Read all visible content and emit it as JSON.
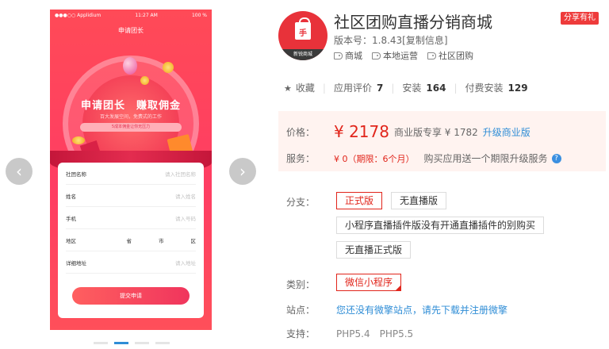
{
  "gallery": {
    "prev_icon": "chevron-left-icon",
    "next_icon": "chevron-right-icon",
    "prev_glyph": "‹",
    "next_glyph": "›",
    "phone": {
      "carrier": "●●●○○ Applidium",
      "time": "11:27 AM",
      "battery": "100 %",
      "header": "申请团长",
      "hero_title": "申请团长　赚取佣金",
      "hero_sub": "百大发展空间，免费式的工作",
      "hero_bar": "5成本佣金让你无压力",
      "form": {
        "rows": [
          {
            "label": "社团名称",
            "placeholder": "请入社团名称"
          },
          {
            "label": "姓名",
            "placeholder": "请入姓名"
          },
          {
            "label": "手机",
            "placeholder": "请入号码"
          }
        ],
        "region_label": "地区",
        "region_parts": [
          "省",
          "市",
          "区"
        ],
        "address_label": "详细地址",
        "address_placeholder": "请入地址",
        "submit": "提交申请"
      }
    }
  },
  "app": {
    "icon_glyph": "手",
    "icon_band": "新锐商城",
    "title": "社区团购直播分销商城",
    "share": "分享有礼",
    "version_label": "版本号：1.8.43",
    "version_link": "[复制信息]",
    "tags": [
      "商城",
      "本地运营",
      "社区团购"
    ]
  },
  "stats": {
    "favorite_label": "收藏",
    "rating_label": "应用评价",
    "rating_value": "7",
    "install_label": "安装",
    "install_value": "164",
    "paid_label": "付费安装",
    "paid_value": "129"
  },
  "price": {
    "label": "价格：",
    "amount": "¥ 2178",
    "pro_text": "商业版专享 ¥ 1782",
    "upgrade_link": "升级商业版",
    "service_label": "服务：",
    "service_value": "¥ 0（期限：6个月）",
    "service_desc": "购买应用送一个期限升级服务"
  },
  "branch": {
    "label": "分支：",
    "options": [
      "正式版",
      "无直播版",
      "小程序直播插件版没有开通直播插件的别购买",
      "无直播正式版"
    ]
  },
  "category": {
    "label": "类别：",
    "value": "微信小程序"
  },
  "site": {
    "label": "站点：",
    "text": "您还没有微擎站点，请先下载并注册微擎"
  },
  "support": {
    "label": "支持：",
    "value": "PHP5.4　PHP5.5"
  },
  "colors": {
    "accent": "#e1251b",
    "link": "#2f8dd6",
    "price_bg": "#fff3f0"
  }
}
